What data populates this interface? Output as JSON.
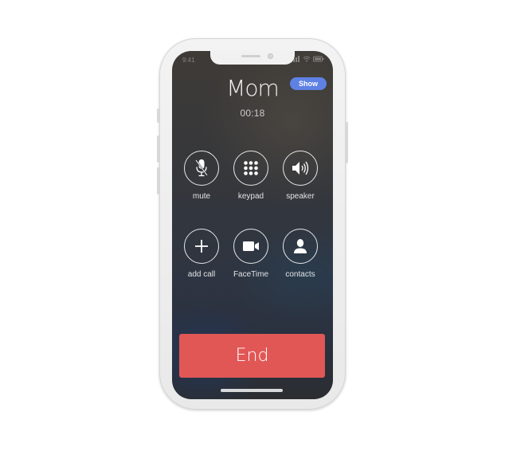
{
  "status_bar": {
    "time": "9:41"
  },
  "call": {
    "caller_name": "Mom",
    "duration": "00:18",
    "show_button_label": "Show"
  },
  "controls": [
    {
      "label": "mute",
      "icon": "microphone-muted-icon"
    },
    {
      "label": "keypad",
      "icon": "keypad-icon"
    },
    {
      "label": "speaker",
      "icon": "speaker-icon"
    },
    {
      "label": "add call",
      "icon": "plus-icon"
    },
    {
      "label": "FaceTime",
      "icon": "video-camera-icon"
    },
    {
      "label": "contacts",
      "icon": "person-icon"
    }
  ],
  "end_button_label": "End",
  "colors": {
    "end_button": "#e05756",
    "show_button": "#5f81e5",
    "screen_dark": "#2a3140"
  }
}
